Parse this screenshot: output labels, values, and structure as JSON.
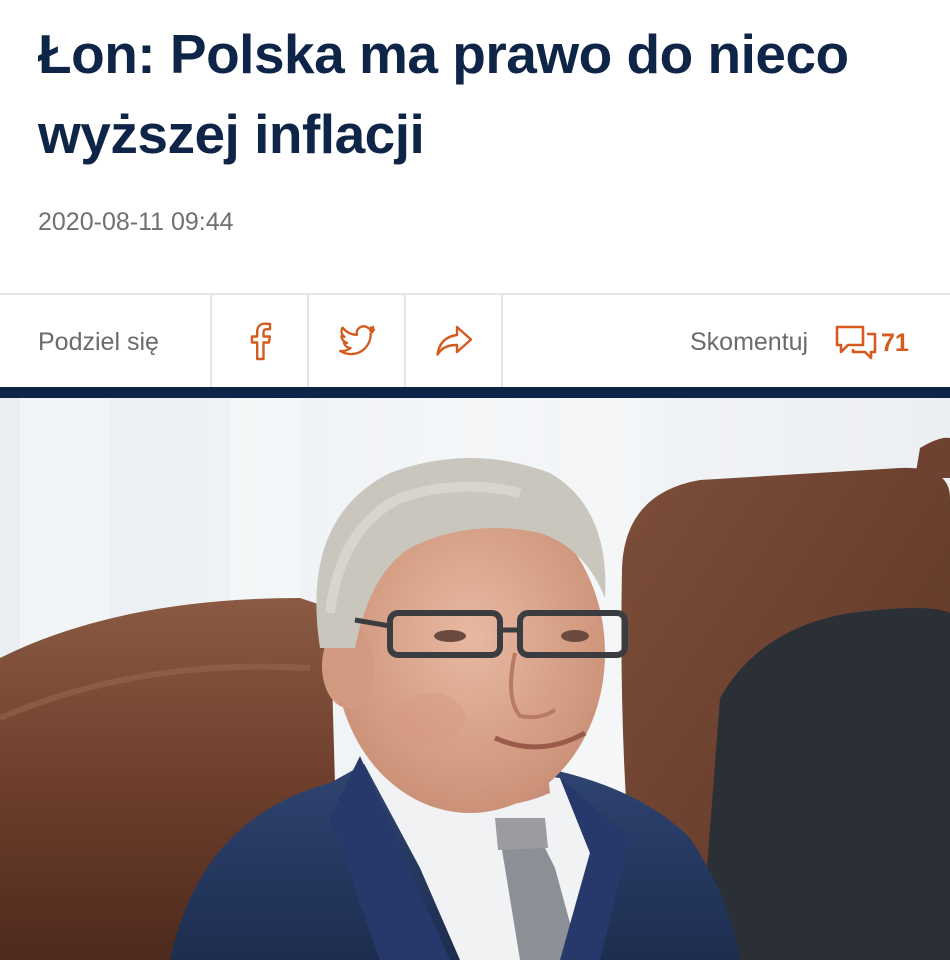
{
  "article": {
    "headline": "Łon: Polska ma prawo do nieco wyższej inflacji",
    "date": "2020-08-11 09:44"
  },
  "share": {
    "label": "Podziel się",
    "buttons": [
      {
        "name": "facebook",
        "icon": "facebook-icon"
      },
      {
        "name": "twitter",
        "icon": "twitter-icon"
      },
      {
        "name": "share",
        "icon": "share-arrow-icon"
      }
    ]
  },
  "comments": {
    "label": "Skomentuj",
    "count": "71",
    "icon": "comment-bubbles-icon"
  },
  "colors": {
    "headline": "#0f2548",
    "accent": "#d45a1e",
    "divider": "#0f2548",
    "muted_text": "#6b6b6b"
  },
  "photo": {
    "subject": "smiling man with grey hair and glasses in navy suit seated in brown leather chair"
  }
}
